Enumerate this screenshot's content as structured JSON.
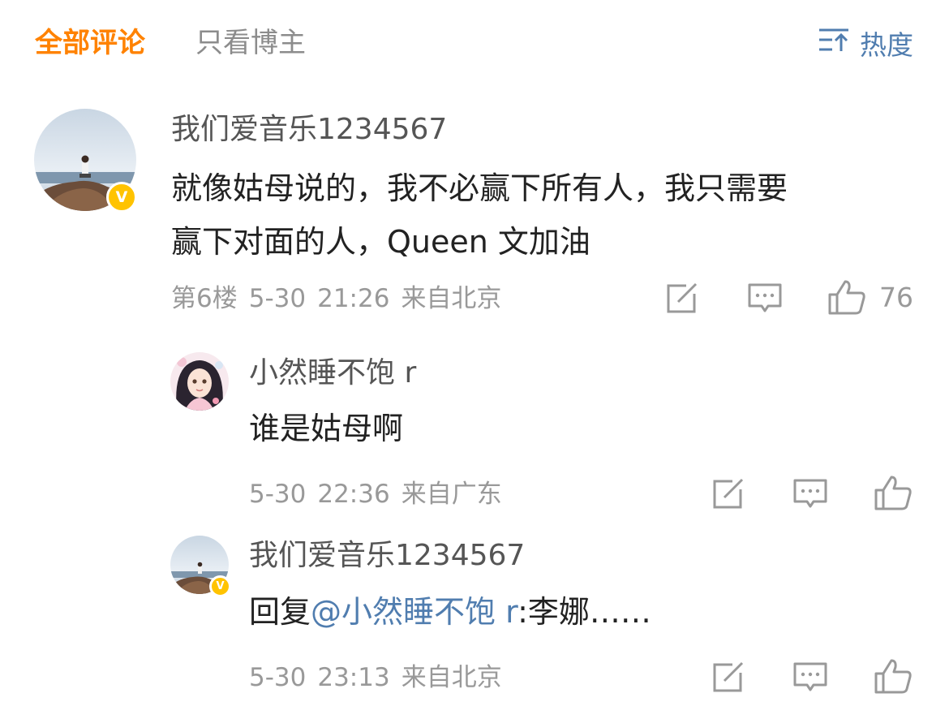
{
  "tabs": {
    "all": "全部评论",
    "owner_only": "只看博主"
  },
  "sort": {
    "label": "热度",
    "icon": "sort-icon"
  },
  "comment": {
    "username": "我们爱音乐1234567",
    "verified": "V",
    "content_line1": "就像姑母说的，我不必赢下所有人，我只需要",
    "content_line2": "赢下对面的人，Queen 文加油",
    "floor": "第6楼",
    "date": "5-30",
    "time": "21:26",
    "location": "来自北京",
    "likes": "76"
  },
  "replies": [
    {
      "username": "小然睡不饱 r",
      "content": "谁是姑母啊",
      "date": "5-30",
      "time": "22:36",
      "location": "来自广东"
    },
    {
      "username": "我们爱音乐1234567",
      "verified": "V",
      "reply_prefix": "回复",
      "mention": "@小然睡不饱 r",
      "reply_text": ":李娜……",
      "date": "5-30",
      "time": "23:13",
      "location": "来自北京"
    }
  ],
  "colors": {
    "active_tab": "#ff8200",
    "inactive_tab": "#8c8c8c",
    "link_blue": "#507daf",
    "verified_badge": "#ffc300",
    "meta_gray": "#999999"
  }
}
